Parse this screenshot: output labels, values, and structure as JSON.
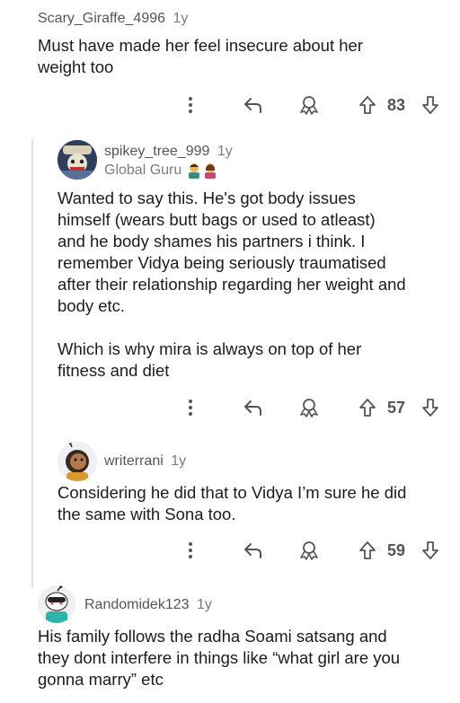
{
  "comments": [
    {
      "username": "Scary_Giraffe_4996",
      "age": "1y",
      "body": [
        "Must have made her feel insecure about her",
        "weight too"
      ],
      "votes": "83"
    },
    {
      "username": "spikey_tree_999",
      "age": "1y",
      "flair": "Global Guru",
      "body": [
        "Wanted to say this. He's got body issues",
        "himself (wears butt bags or used to atleast)",
        "and he body shames his partners i think. I",
        "remember Vidya being seriously traumatised",
        "after their relationship regarding her weight and",
        "body etc.",
        "",
        "Which is why mira is always on top of her",
        "fitness and diet"
      ],
      "votes": "57"
    },
    {
      "username": "writerrani",
      "age": "1y",
      "body": [
        "Considering he did that to Vidya I’m sure he did",
        "the same with Sona too."
      ],
      "votes": "59"
    },
    {
      "username": "Randomidek123",
      "age": "1y",
      "body": [
        "His family follows the radha Soami satsang and",
        "they dont interfere in things like “what girl are you",
        "gonna marry” etc"
      ]
    }
  ],
  "icons": {
    "more": "more-vertical-icon",
    "reply": "reply-arrow-icon",
    "award": "award-icon",
    "upvote": "upvote-arrow-icon",
    "downvote": "downvote-arrow-icon"
  }
}
